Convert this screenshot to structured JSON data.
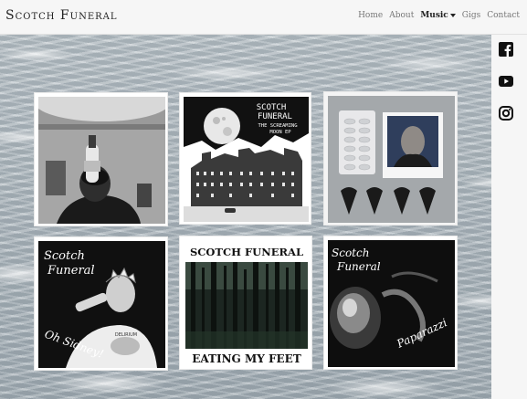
{
  "header": {
    "brand": "Scotch Funeral",
    "nav": [
      {
        "label": "Home"
      },
      {
        "label": "About"
      },
      {
        "label": "Music"
      },
      {
        "label": "Gigs"
      },
      {
        "label": "Contact"
      }
    ],
    "active_nav": "Music"
  },
  "social": [
    "facebook-icon",
    "youtube-icon",
    "instagram-icon"
  ],
  "gallery": {
    "cover2": {
      "line1": "SCOTCH",
      "line2": "FUNERAL",
      "line3": "THE SCREAMING",
      "line4": "MOON EP"
    },
    "cover5": {
      "top": "SCOTCH FUNERAL",
      "bottom": "EATING MY FEET"
    },
    "cover4": {
      "logo1": "Scotch",
      "logo2": "Funeral",
      "tag": "Oh Sidney!",
      "shirt": "DELIRIUM"
    },
    "cover6": {
      "logo1": "Scotch",
      "logo2": "Funeral",
      "tag": "Paparazzi"
    }
  },
  "colors": {
    "header_bg": "#f6f6f6",
    "text": "#222222",
    "nav": "#777777"
  }
}
